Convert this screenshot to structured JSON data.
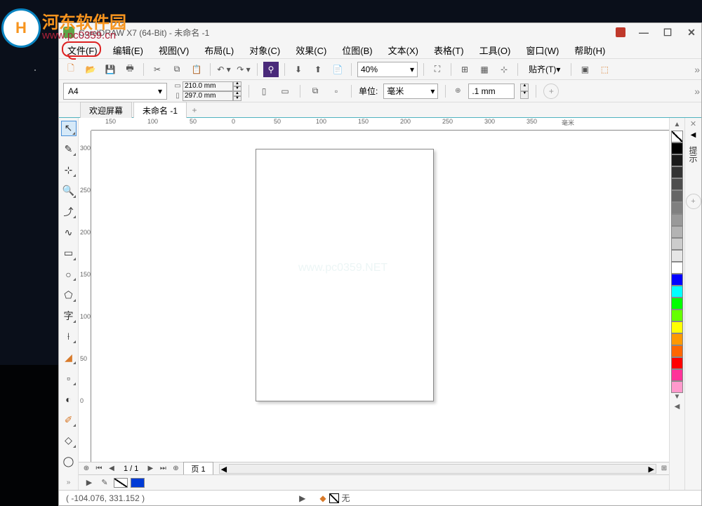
{
  "watermark": {
    "site": "河东软件园",
    "url": "www.pc0359.cn"
  },
  "titlebar": {
    "title": "CorelDRAW X7 (64-Bit) - 未命名 -1"
  },
  "menubar": {
    "file": "文件(F)",
    "edit": "编辑(E)",
    "view": "视图(V)",
    "layout": "布局(L)",
    "object": "对象(C)",
    "effect": "效果(C)",
    "bitmap": "位图(B)",
    "text": "文本(X)",
    "table": "表格(T)",
    "tools": "工具(O)",
    "window": "窗口(W)",
    "help": "帮助(H)"
  },
  "toolbar1": {
    "zoom": "40%",
    "snap": "贴齐(T)"
  },
  "toolbar2": {
    "paper": "A4",
    "width": "210.0 mm",
    "height": "297.0 mm",
    "unit_label": "单位:",
    "unit": "毫米",
    "nudge": ".1 mm"
  },
  "tabs": {
    "welcome": "欢迎屏幕",
    "doc": "未命名 -1"
  },
  "ruler_h": [
    "150",
    "100",
    "50",
    "0",
    "50",
    "100",
    "150",
    "200",
    "250",
    "300",
    "350",
    "毫米"
  ],
  "ruler_v": [
    "300",
    "250",
    "200",
    "150",
    "100",
    "50",
    "0"
  ],
  "canvas_watermark": "www.pc0359.NET",
  "page_nav": {
    "counter": "1 / 1",
    "page_tab": "页 1"
  },
  "fillbar": {
    "none": "无"
  },
  "statusbar": {
    "coords": "( -104.076, 331.152 )"
  },
  "docker": {
    "hint": "提示"
  },
  "palette": [
    "#000000",
    "#1a1a1a",
    "#333333",
    "#4d4d4d",
    "#666666",
    "#808080",
    "#999999",
    "#b3b3b3",
    "#cccccc",
    "#e6e6e6",
    "#ffffff",
    "#0000ff",
    "#00ffff",
    "#00ff00",
    "#66ff00",
    "#ffff00",
    "#ff9900",
    "#ff6600",
    "#ff0000",
    "#ff3399",
    "#ff99cc"
  ]
}
